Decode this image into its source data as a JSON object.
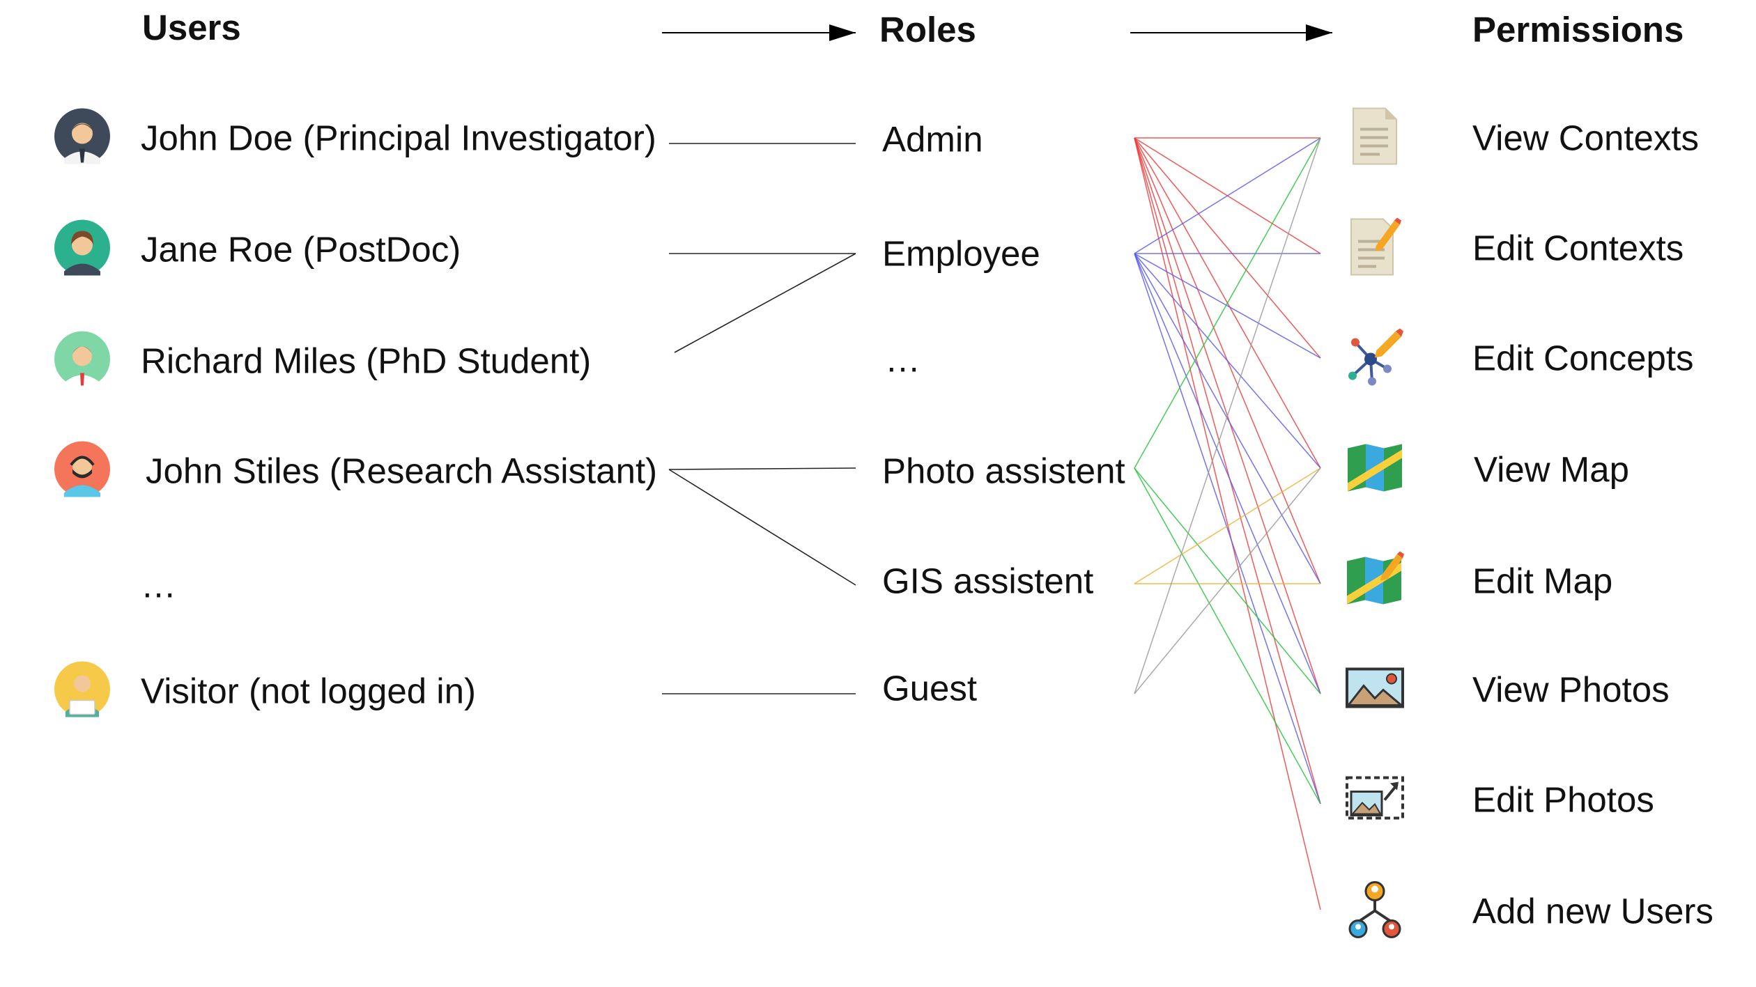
{
  "headers": {
    "users": "Users",
    "roles": "Roles",
    "permissions": "Permissions"
  },
  "users": [
    {
      "id": "john-doe",
      "label": "John Doe (Principal Investigator)",
      "icon": "avatar-man-suit-icon",
      "bg": "#3e4a59"
    },
    {
      "id": "jane-roe",
      "label": "Jane Roe (PostDoc)",
      "icon": "avatar-woman-icon",
      "bg": "#2bb18e"
    },
    {
      "id": "richard-miles",
      "label": "Richard Miles (PhD Student)",
      "icon": "avatar-man-tie-icon",
      "bg": "#7fd6a6"
    },
    {
      "id": "john-stiles",
      "label": "John Stiles (Research Assistant)",
      "icon": "avatar-man-headset-icon",
      "bg": "#f4755a"
    },
    {
      "id": "more-users",
      "label": "…",
      "icon": ""
    },
    {
      "id": "visitor",
      "label": "Visitor (not logged in)",
      "icon": "avatar-man-laptop-icon",
      "bg": "#f7c948"
    }
  ],
  "roles": [
    {
      "id": "admin",
      "label": "Admin"
    },
    {
      "id": "employee",
      "label": "Employee"
    },
    {
      "id": "more-roles",
      "label": "…"
    },
    {
      "id": "photo-assistent",
      "label": "Photo assistent"
    },
    {
      "id": "gis-assistent",
      "label": "GIS assistent"
    },
    {
      "id": "guest",
      "label": "Guest"
    }
  ],
  "permissions": [
    {
      "id": "view-contexts",
      "label": "View Contexts",
      "icon": "document-icon"
    },
    {
      "id": "edit-contexts",
      "label": "Edit Contexts",
      "icon": "edit-document-icon"
    },
    {
      "id": "edit-concepts",
      "label": "Edit Concepts",
      "icon": "concept-network-icon"
    },
    {
      "id": "view-map",
      "label": "View Map",
      "icon": "map-icon"
    },
    {
      "id": "edit-map",
      "label": "Edit Map",
      "icon": "edit-map-icon"
    },
    {
      "id": "view-photos",
      "label": "View Photos",
      "icon": "photo-icon"
    },
    {
      "id": "edit-photos",
      "label": "Edit Photos",
      "icon": "edit-photo-icon"
    },
    {
      "id": "add-new-users",
      "label": "Add new Users",
      "icon": "user-hierarchy-icon"
    }
  ],
  "user_role_links": [
    [
      "john-doe",
      "admin"
    ],
    [
      "jane-roe",
      "employee"
    ],
    [
      "richard-miles",
      "employee"
    ],
    [
      "john-stiles",
      "photo-assistent"
    ],
    [
      "john-stiles",
      "gis-assistent"
    ],
    [
      "visitor",
      "guest"
    ]
  ],
  "role_colors": {
    "admin": "#ef3b3b",
    "employee": "#5b5bef",
    "photo-assistent": "#27c33a",
    "gis-assistent": "#f0b030",
    "guest": "#9a9a9a"
  },
  "role_permission_links": [
    [
      "admin",
      "view-contexts"
    ],
    [
      "admin",
      "edit-contexts"
    ],
    [
      "admin",
      "edit-concepts"
    ],
    [
      "admin",
      "view-map"
    ],
    [
      "admin",
      "edit-map"
    ],
    [
      "admin",
      "view-photos"
    ],
    [
      "admin",
      "edit-photos"
    ],
    [
      "admin",
      "add-new-users"
    ],
    [
      "employee",
      "view-contexts"
    ],
    [
      "employee",
      "edit-contexts"
    ],
    [
      "employee",
      "edit-concepts"
    ],
    [
      "employee",
      "view-map"
    ],
    [
      "employee",
      "edit-map"
    ],
    [
      "employee",
      "view-photos"
    ],
    [
      "employee",
      "edit-photos"
    ],
    [
      "photo-assistent",
      "view-contexts"
    ],
    [
      "photo-assistent",
      "view-photos"
    ],
    [
      "photo-assistent",
      "edit-photos"
    ],
    [
      "gis-assistent",
      "view-map"
    ],
    [
      "gis-assistent",
      "edit-map"
    ],
    [
      "guest",
      "view-contexts"
    ],
    [
      "guest",
      "view-map"
    ]
  ]
}
